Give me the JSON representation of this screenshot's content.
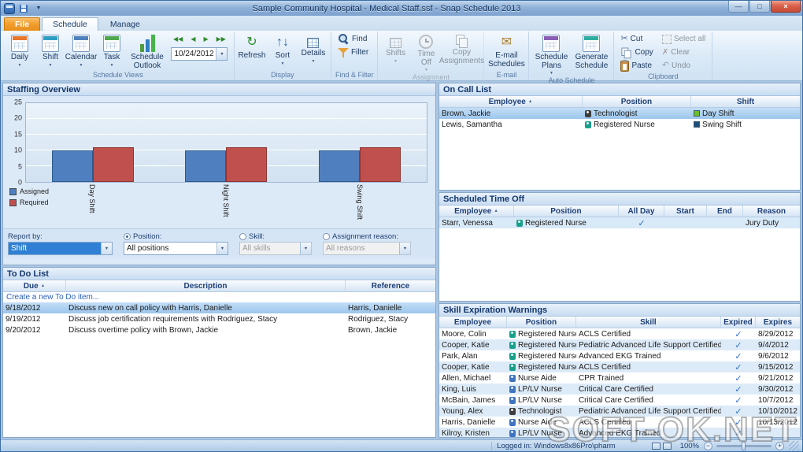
{
  "window": {
    "title": "Sample Community Hospital - Medical Staff.ssf - Snap Schedule 2013",
    "controls": {
      "minimize": "—",
      "maximize": "□",
      "close": "×"
    }
  },
  "glyphs": {
    "check": "✓",
    "nav_first": "◀◀",
    "nav_prev": "◀",
    "nav_next": "▶",
    "nav_last": "▶▶"
  },
  "ribbon": {
    "tabs": {
      "file": "File",
      "schedule": "Schedule",
      "manage": "Manage"
    },
    "schedule_views": {
      "label": "Schedule Views",
      "daily": "Daily",
      "shift": "Shift",
      "calendar": "Calendar",
      "task": "Task",
      "outlook": "Schedule Outlook",
      "date": "10/24/2012"
    },
    "display": {
      "label": "Display",
      "refresh": "Refresh",
      "sort": "Sort",
      "details": "Details"
    },
    "find_filter": {
      "label": "Find & Filter",
      "find": "Find",
      "filter": "Filter"
    },
    "assignment": {
      "label": "Assignment",
      "shifts": "Shifts",
      "time_off": "Time Off",
      "copy_assignments": "Copy Assignments"
    },
    "email": {
      "label": "E-mail",
      "email_schedules": "E-mail Schedules"
    },
    "auto_schedule": {
      "label": "Auto Schedule",
      "schedule_plans": "Schedule Plans",
      "generate_schedule": "Generate Schedule"
    },
    "clipboard": {
      "label": "Clipboard",
      "cut": "Cut",
      "copy": "Copy",
      "paste": "Paste",
      "select_all": "Select all",
      "clear": "Clear",
      "undo": "Undo"
    }
  },
  "staffing_overview": {
    "title": "Staffing Overview",
    "chart_data": {
      "type": "bar",
      "categories": [
        "Day Shift",
        "Night Shift",
        "Swing Shift"
      ],
      "series": [
        {
          "name": "Assigned",
          "color": "#4f7fbf",
          "border": "#2d5a8e",
          "values": [
            10,
            10,
            10
          ]
        },
        {
          "name": "Required",
          "color": "#c0504d",
          "border": "#8e3330",
          "values": [
            11,
            11,
            11
          ]
        }
      ],
      "ylim": [
        0,
        25
      ],
      "yticks": [
        0,
        5,
        10,
        15,
        20,
        25
      ],
      "grid": true,
      "legend_position": "bottom-left"
    },
    "filters": {
      "report_by_label": "Report by:",
      "report_by_value": "Shift",
      "position_label": "Position:",
      "position_value": "All positions",
      "skill_label": "Skill:",
      "skill_value": "All skills",
      "reason_label": "Assignment reason:",
      "reason_value": "All reasons"
    }
  },
  "todo": {
    "title": "To Do List",
    "columns": {
      "due": "Due",
      "description": "Description",
      "reference": "Reference"
    },
    "new_item_link": "Create a new To Do item...",
    "rows": [
      {
        "due": "9/18/2012",
        "description": "Discuss new on call policy with Harris, Danielle",
        "reference": "Harris, Danielle"
      },
      {
        "due": "9/19/2012",
        "description": "Discuss job certification requirements with Rodriguez, Stacy",
        "reference": "Rodriguez, Stacy"
      },
      {
        "due": "9/20/2012",
        "description": "Discuss overtime policy with Brown, Jackie",
        "reference": "Brown, Jackie"
      }
    ]
  },
  "on_call": {
    "title": "On Call List",
    "columns": {
      "employee": "Employee",
      "position": "Position",
      "shift": "Shift"
    },
    "rows": [
      {
        "employee": "Brown, Jackie",
        "position": "Technologist",
        "position_color": "#3d3d3d",
        "shift": "Day Shift",
        "shift_color": "#6cbf2b",
        "selected": true
      },
      {
        "employee": "Lewis, Samantha",
        "position": "Registered Nurse",
        "position_color": "#19a08c",
        "shift": "Swing Shift",
        "shift_color": "#1f4e79",
        "selected": false
      }
    ]
  },
  "time_off": {
    "title": "Scheduled Time Off",
    "columns": {
      "employee": "Employee",
      "position": "Position",
      "all_day": "All Day",
      "start": "Start",
      "end": "End",
      "reason": "Reason"
    },
    "rows": [
      {
        "employee": "Starr, Venessa",
        "position": "Registered Nurse",
        "position_color": "#19a08c",
        "all_day": true,
        "start": "",
        "end": "",
        "reason": "Jury Duty"
      }
    ]
  },
  "skill_warnings": {
    "title": "Skill Expiration Warnings",
    "columns": {
      "employee": "Employee",
      "position": "Position",
      "skill": "Skill",
      "expired": "Expired",
      "expires": "Expires"
    },
    "rows": [
      {
        "employee": "Moore, Colin",
        "position": "Registered Nurse",
        "position_color": "#19a08c",
        "skill": "ACLS Certified",
        "expired": true,
        "expires": "8/29/2012"
      },
      {
        "employee": "Cooper, Katie",
        "position": "Registered Nurse",
        "position_color": "#19a08c",
        "skill": "Pediatric Advanced Life Support Certified",
        "expired": true,
        "expires": "9/4/2012"
      },
      {
        "employee": "Park, Alan",
        "position": "Registered Nurse",
        "position_color": "#19a08c",
        "skill": "Advanced EKG Trained",
        "expired": true,
        "expires": "9/6/2012"
      },
      {
        "employee": "Cooper, Katie",
        "position": "Registered Nurse",
        "position_color": "#19a08c",
        "skill": "ACLS Certified",
        "expired": true,
        "expires": "9/15/2012"
      },
      {
        "employee": "Allen, Michael",
        "position": "Nurse Aide",
        "position_color": "#3f74c0",
        "skill": "CPR Trained",
        "expired": true,
        "expires": "9/21/2012"
      },
      {
        "employee": "King, Luis",
        "position": "LP/LV Nurse",
        "position_color": "#3f74c0",
        "skill": "Critical Care Certified",
        "expired": true,
        "expires": "9/30/2012"
      },
      {
        "employee": "McBain, James",
        "position": "LP/LV Nurse",
        "position_color": "#3f74c0",
        "skill": "Critical Care Certified",
        "expired": true,
        "expires": "10/7/2012"
      },
      {
        "employee": "Young, Alex",
        "position": "Technologist",
        "position_color": "#3d3d3d",
        "skill": "Pediatric Advanced Life Support Certified",
        "expired": true,
        "expires": "10/10/2012"
      },
      {
        "employee": "Harris, Danielle",
        "position": "Nurse Aide",
        "position_color": "#3f74c0",
        "skill": "ACLS Certified",
        "expired": true,
        "expires": "10/13/2012"
      },
      {
        "employee": "Kilroy, Kristen",
        "position": "LP/LV Nurse",
        "position_color": "#3f74c0",
        "skill": "Advanced EKG Trained",
        "expired": true,
        "expires": ""
      }
    ]
  },
  "status_bar": {
    "logged_in": "Logged in: Windows8x86Pro\\pharm",
    "zoom": "100%",
    "zoom_out": "−",
    "zoom_in": "+"
  },
  "watermark": "SOFT-OK.NET"
}
